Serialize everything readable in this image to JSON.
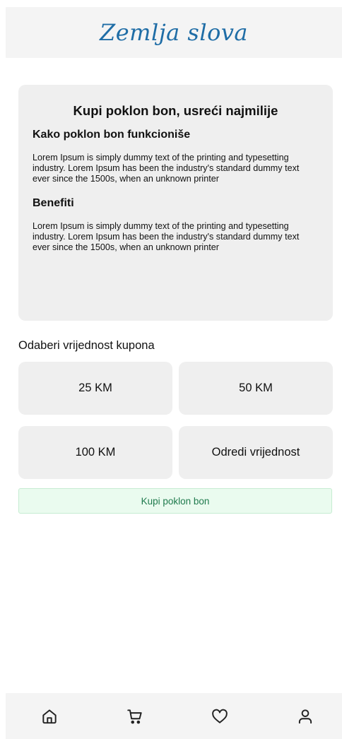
{
  "header": {
    "logo_text": "Zemlja slova"
  },
  "info_card": {
    "title_bold": "Kupi poklon bon,",
    "title_rest": " usreći najmilije",
    "how_heading": "Kako poklon bon funkcioniše",
    "how_text": "Lorem Ipsum is simply dummy text of the printing and typesetting industry. Lorem Ipsum has been the industry's standard dummy text ever since the 1500s, when an unknown printer",
    "benefits_heading": "Benefiti",
    "benefits_text": "Lorem Ipsum is simply dummy text of the printing and typesetting industry. Lorem Ipsum has been the industry's standard dummy text ever since the 1500s, when an unknown printer"
  },
  "voucher": {
    "select_label": "Odaberi vrijednost kupona",
    "options": [
      {
        "label": "25 KM"
      },
      {
        "label": "50 KM"
      },
      {
        "label": "100 KM"
      },
      {
        "label": "Odredi vrijednost"
      }
    ],
    "buy_label": "Kupi poklon bon"
  },
  "nav": {
    "items": [
      {
        "icon": "home-icon"
      },
      {
        "icon": "cart-icon"
      },
      {
        "icon": "heart-icon"
      },
      {
        "icon": "user-icon"
      }
    ]
  },
  "colors": {
    "logo": "#1f6da6",
    "card_bg": "#efefef",
    "buy_button_bg": "#eafbef",
    "buy_button_text": "#1f7a4d"
  }
}
